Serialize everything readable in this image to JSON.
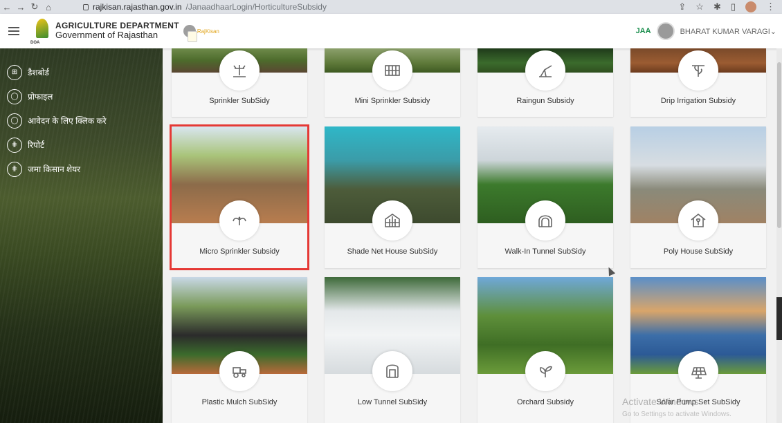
{
  "browser": {
    "url_host": "rajkisan.rajasthan.gov.in",
    "url_path": "/JanaadhaarLogin/HorticultureSubsidy"
  },
  "header": {
    "brand_line1": "AGRICULTURE DEPARTMENT",
    "brand_line2": "Government of Rajasthan",
    "logo_small": "DOA",
    "rajkisan": "RajKisan",
    "jan_aadhaar": "JAA",
    "user_name": "BHARAT KUMAR VARAGI",
    "user_caret": "⌄"
  },
  "sidebar": {
    "items": [
      {
        "label": "डैशबोर्ड",
        "icon": "dashboard-icon",
        "glyph": "⊞"
      },
      {
        "label": "प्रोफाइल",
        "icon": "profile-icon",
        "glyph": "◯"
      },
      {
        "label": "आवेदन के लिए क्लिक करे",
        "icon": "apply-icon",
        "glyph": "◯"
      },
      {
        "label": "रिपोर्ट",
        "icon": "report-icon",
        "glyph": "⋕"
      },
      {
        "label": "जमा किसान शेयर",
        "icon": "share-icon",
        "glyph": "⋕"
      }
    ]
  },
  "cards": [
    {
      "label": "Sprinkler SubSidy",
      "icon": "sprinkler-icon"
    },
    {
      "label": "Mini Sprinkler Subsidy",
      "icon": "mini-sprinkler-icon"
    },
    {
      "label": "Raingun Subsidy",
      "icon": "raingun-icon"
    },
    {
      "label": "Drip Irrigation Subsidy",
      "icon": "drip-irrigation-icon"
    },
    {
      "label": "Micro Sprinkler Subsidy",
      "icon": "micro-sprinkler-icon"
    },
    {
      "label": "Shade Net House SubSidy",
      "icon": "greenhouse-icon"
    },
    {
      "label": "Walk-In Tunnel SubSidy",
      "icon": "tunnel-icon"
    },
    {
      "label": "Poly House SubSidy",
      "icon": "poly-house-icon"
    },
    {
      "label": "Plastic Mulch SubSidy",
      "icon": "tractor-icon"
    },
    {
      "label": "Low Tunnel SubSidy",
      "icon": "low-tunnel-icon"
    },
    {
      "label": "Orchard Subsidy",
      "icon": "plant-icon"
    },
    {
      "label": "Solar Pump Set SubSidy",
      "icon": "solar-panel-icon"
    }
  ],
  "watermark": {
    "title": "Activate Windows",
    "subtitle": "Go to Settings to activate Windows."
  }
}
